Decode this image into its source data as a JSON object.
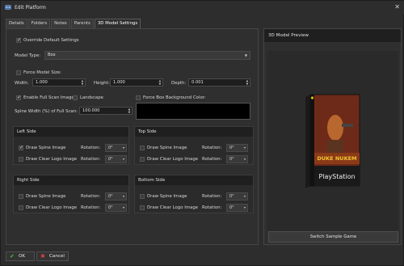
{
  "window": {
    "title": "Edit Platform",
    "close_glyph": "✕",
    "app_icon": "platform-icon"
  },
  "tabs": [
    {
      "label": "Details"
    },
    {
      "label": "Folders"
    },
    {
      "label": "Notes"
    },
    {
      "label": "Parents"
    },
    {
      "label": "3D Model Settings",
      "active": true
    }
  ],
  "settings": {
    "override_label": "Override Default Settings",
    "override_checked": true,
    "model_type_label": "Model Type:",
    "model_type_value": "Box",
    "force_size_label": "Force Model Size:",
    "force_size_checked": false,
    "width_label": "Width:",
    "width_value": "1.000",
    "height_label": "Height:",
    "height_value": "1.000",
    "depth_label": "Depth:",
    "depth_value": "0.001",
    "full_scan_label": "Enable Full Scan Images:",
    "full_scan_checked": true,
    "landscape_label": "Landscape",
    "landscape_checked": false,
    "force_bg_label": "Force Box Background Color:",
    "force_bg_checked": false,
    "force_bg_color": "#000000",
    "spine_width_label": "Spine Width (%) of Full Scan:",
    "spine_width_value": "100.000"
  },
  "groups": {
    "left_side": {
      "title": "Left Side",
      "spine_label": "Draw Spine Image",
      "spine_checked": true,
      "spine_rotation_label": "Rotation:",
      "spine_rotation": "0°",
      "logo_label": "Draw Clear Logo Image",
      "logo_checked": false,
      "logo_rotation_label": "Rotation:",
      "logo_rotation": "0°"
    },
    "top_side": {
      "title": "Top Side",
      "spine_label": "Draw Spine Image",
      "spine_checked": false,
      "spine_rotation_label": "Rotation:",
      "spine_rotation": "0°",
      "logo_label": "Draw Clear Logo Image",
      "logo_checked": false,
      "logo_rotation_label": "Rotation:",
      "logo_rotation": "0°"
    },
    "right_side": {
      "title": "Right Side",
      "spine_label": "Draw Spine Image",
      "spine_checked": false,
      "spine_rotation_label": "Rotation:",
      "spine_rotation": "0°",
      "logo_label": "Draw Clear Logo Image",
      "logo_checked": false,
      "logo_rotation_label": "Rotation:",
      "logo_rotation": "0°"
    },
    "bottom_side": {
      "title": "Bottom Side",
      "spine_label": "Draw Spine Image",
      "spine_checked": false,
      "spine_rotation_label": "Rotation:",
      "spine_rotation": "0°",
      "logo_label": "Draw Clear Logo Image",
      "logo_checked": false,
      "logo_rotation_label": "Rotation:",
      "logo_rotation": "0°"
    }
  },
  "preview": {
    "header": "3D Model Preview",
    "box_title": "DUKE NUKEM",
    "box_platform": "PlayStation",
    "switch_button": "Switch Sample Game"
  },
  "footer": {
    "ok_label": "OK",
    "ok_icon": "checkmark-icon",
    "cancel_label": "Cancel",
    "cancel_icon": "cancel-icon"
  },
  "colors": {
    "background": "#2d2d2d",
    "panel": "#2f2f2f",
    "header_bar": "#1f1f1f",
    "ok_icon": "#3fbf4f",
    "cancel_icon": "#e04040"
  }
}
